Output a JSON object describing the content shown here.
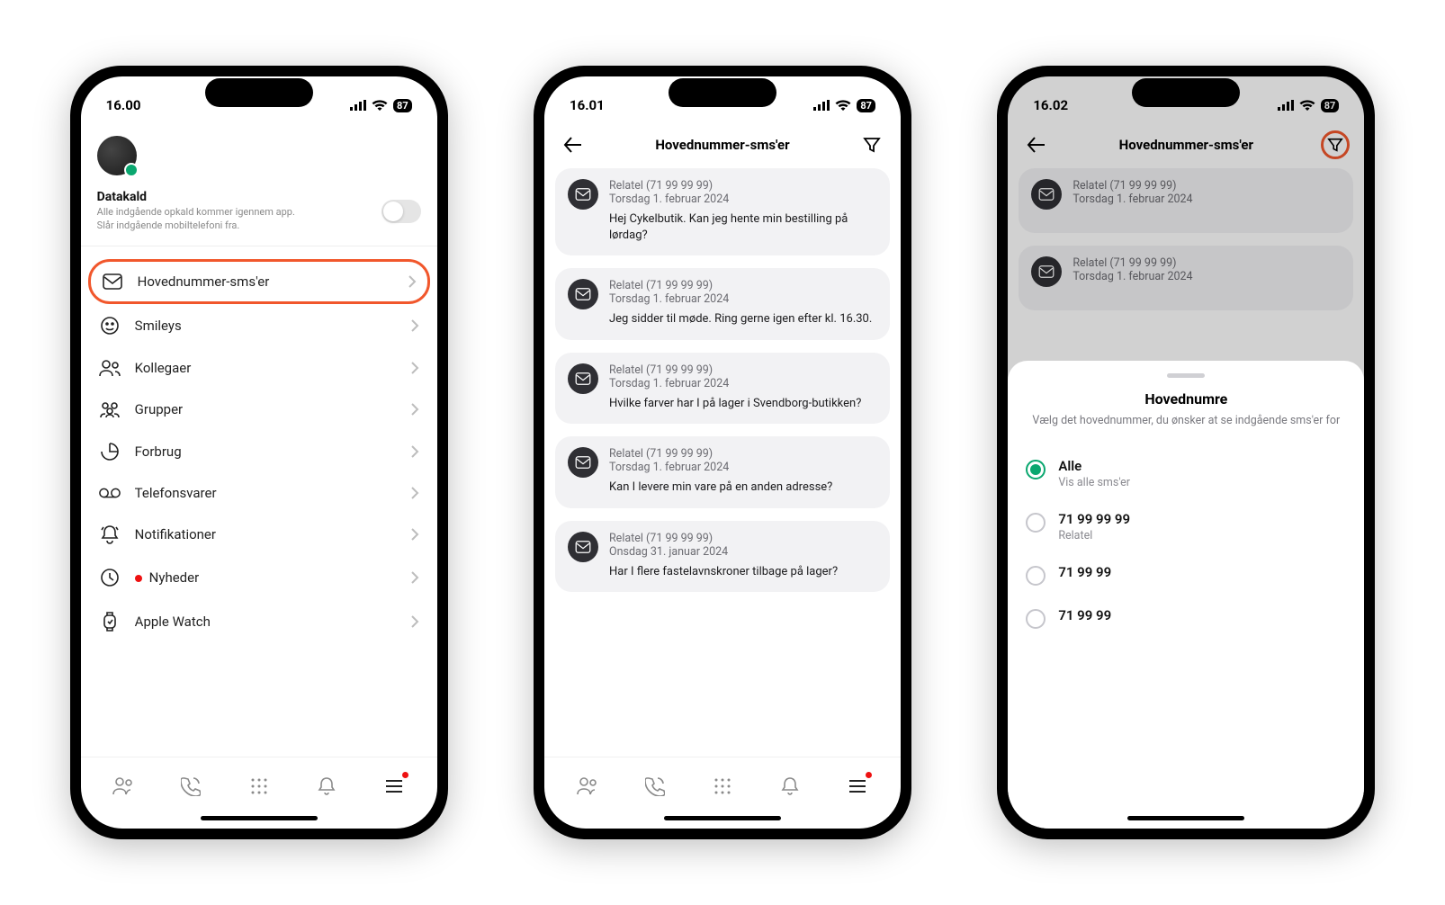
{
  "phone1": {
    "time": "16.00",
    "battery": "87",
    "datakald": {
      "title": "Datakald",
      "line1": "Alle indgående opkald kommer igennem app.",
      "line2": "Slår indgående mobiltelefoni fra."
    },
    "menu": [
      {
        "label": "Hovednummer-sms'er",
        "icon": "mail",
        "highlight": true
      },
      {
        "label": "Smileys",
        "icon": "smiley"
      },
      {
        "label": "Kollegaer",
        "icon": "people"
      },
      {
        "label": "Grupper",
        "icon": "groups"
      },
      {
        "label": "Forbrug",
        "icon": "usage"
      },
      {
        "label": "Telefonsvarer",
        "icon": "voicemail"
      },
      {
        "label": "Notifikationer",
        "icon": "bell"
      },
      {
        "label": "Nyheder",
        "icon": "clock",
        "showDot": true
      },
      {
        "label": "Apple Watch",
        "icon": "watch"
      }
    ]
  },
  "phone2": {
    "time": "16.01",
    "battery": "87",
    "title": "Hovednummer-sms'er",
    "messages": [
      {
        "sender": "Relatel (71 99 99 99)",
        "date": "Torsdag 1. februar 2024",
        "text": "Hej Cykelbutik. Kan jeg hente min bestilling på lørdag?"
      },
      {
        "sender": "Relatel (71 99 99 99)",
        "date": "Torsdag 1. februar 2024",
        "text": "Jeg sidder til møde. Ring gerne igen efter kl. 16.30."
      },
      {
        "sender": "Relatel (71 99 99 99)",
        "date": "Torsdag 1. februar 2024",
        "text": "Hvilke farver har I på lager i Svendborg-butikken?"
      },
      {
        "sender": "Relatel (71 99 99 99)",
        "date": "Torsdag 1. februar 2024",
        "text": "Kan I levere min vare på en anden adresse?"
      },
      {
        "sender": "Relatel (71 99 99 99)",
        "date": "Onsdag 31. januar 2024",
        "text": "Har I flere fastelavnskroner tilbage på lager?"
      }
    ]
  },
  "phone3": {
    "time": "16.02",
    "battery": "87",
    "title": "Hovednummer-sms'er",
    "bg_messages": [
      {
        "sender": "Relatel (71 99 99 99)",
        "date": "Torsdag 1. februar 2024"
      },
      {
        "sender": "Relatel (71 99 99 99)",
        "date": "Torsdag 1. februar 2024"
      }
    ],
    "sheet": {
      "title": "Hovednumre",
      "subtitle": "Vælg det hovednummer, du ønsker at se indgående sms'er for",
      "options": [
        {
          "title": "Alle",
          "sub": "Vis alle sms'er",
          "checked": true
        },
        {
          "title": "71 99 99 99",
          "sub": "Relatel"
        },
        {
          "title": "71 99 99",
          "sub": ""
        },
        {
          "title": "71 99 99",
          "sub": ""
        }
      ]
    }
  }
}
